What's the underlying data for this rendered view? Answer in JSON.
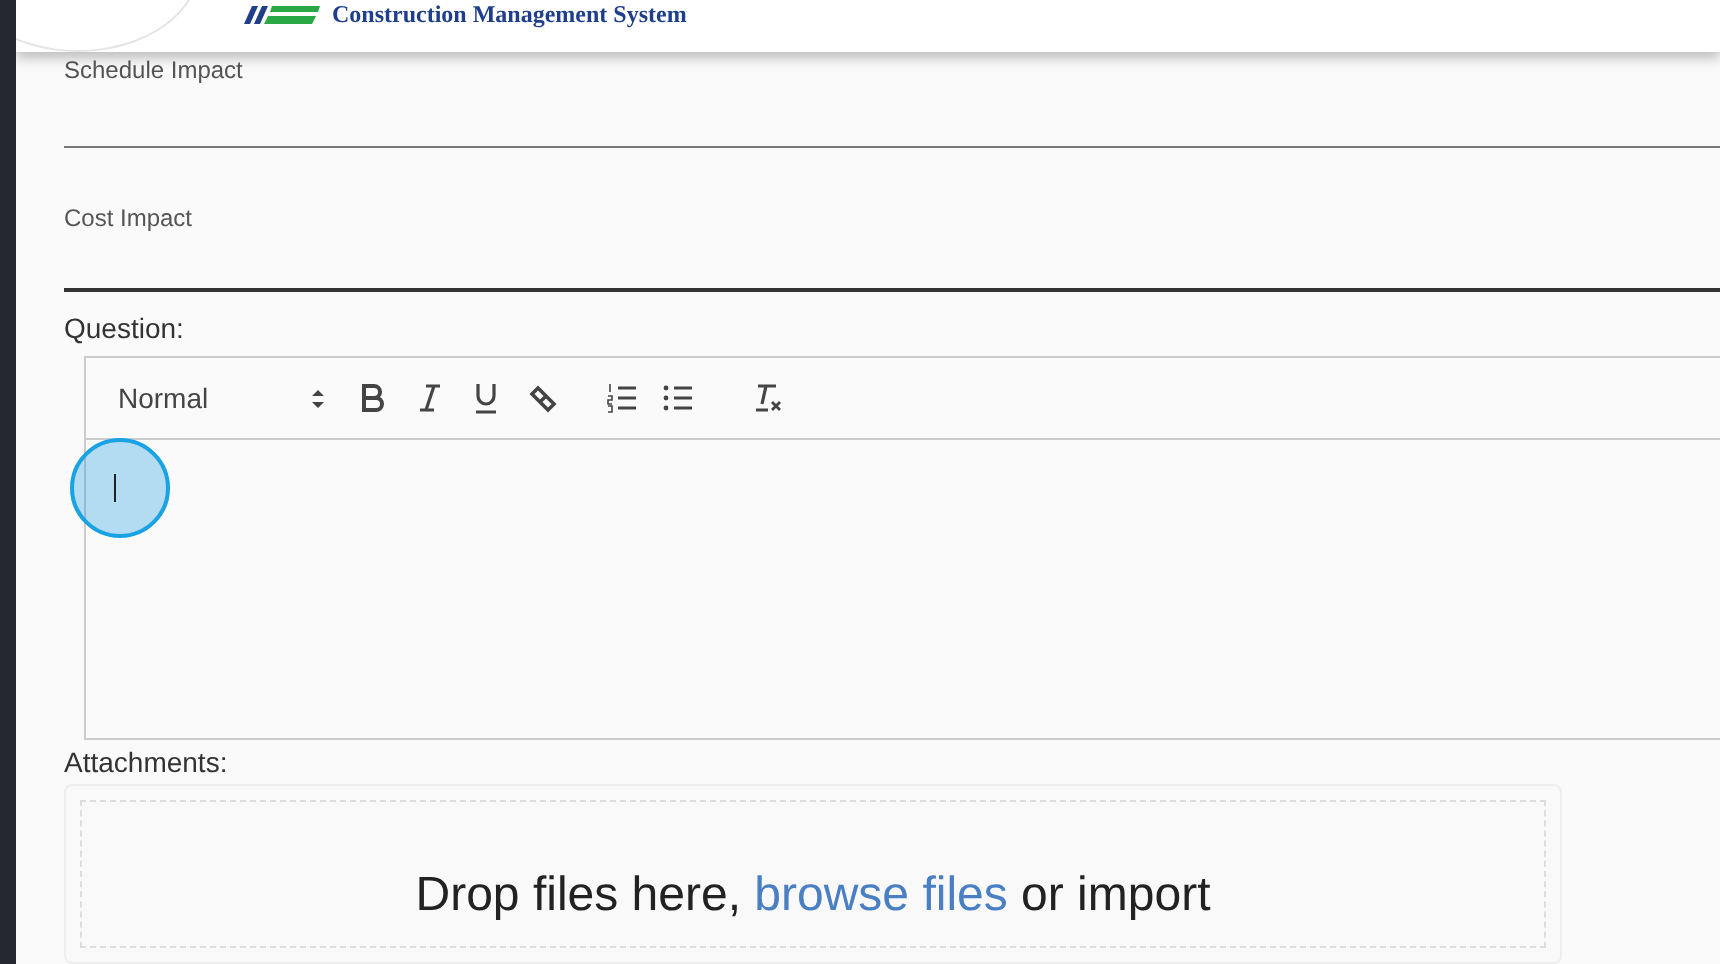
{
  "header": {
    "app_name": "Construction Management System"
  },
  "fields": [
    {
      "label": "Schedule Impact",
      "focused": false
    },
    {
      "label": "Cost Impact",
      "focused": true
    }
  ],
  "question": {
    "label": "Question:",
    "format": "Normal"
  },
  "attachments": {
    "label": "Attachments:",
    "text_before": "Drop files here, ",
    "link": "browse files",
    "text_after": " or import"
  }
}
